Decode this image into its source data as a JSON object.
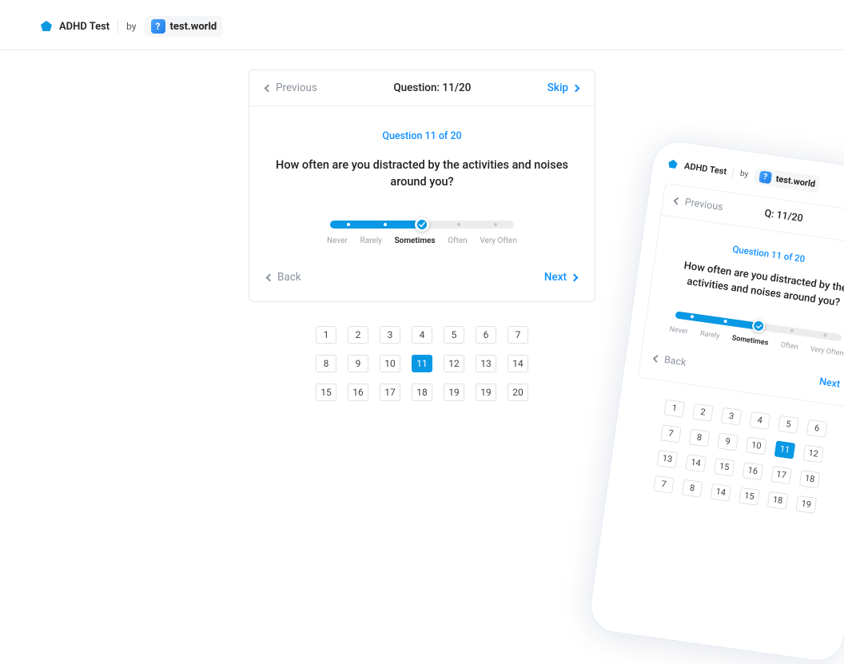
{
  "header": {
    "app_name": "ADHD Test",
    "by_label": "by",
    "brand": "test.world",
    "brand_glyph": "?"
  },
  "card": {
    "prev_label": "Previous",
    "skip_label": "Skip",
    "title_prefix": "Question:",
    "title_value": "11/20",
    "progress": "Question 11 of 20",
    "question": "How often are you distracted by the activities and noises around you?",
    "scale": [
      "Never",
      "Rarely",
      "Sometimes",
      "Often",
      "Very Often"
    ],
    "selected_index": 2,
    "back_label": "Back",
    "next_label": "Next"
  },
  "pager": {
    "total": 20,
    "current": 11,
    "rows": [
      [
        1,
        2,
        3,
        4,
        5,
        6,
        7
      ],
      [
        8,
        9,
        10,
        11,
        12,
        13,
        14
      ],
      [
        15,
        16,
        17,
        18,
        19,
        19,
        20
      ]
    ]
  },
  "phone": {
    "title_prefix": "Q:",
    "title_value": "11/20",
    "pager_rows": [
      [
        1,
        2,
        3,
        4,
        5,
        6
      ],
      [
        7,
        8,
        9,
        10,
        11,
        12
      ],
      [
        13,
        14,
        15,
        16,
        17,
        18
      ],
      [
        7,
        8,
        14,
        15,
        18,
        19
      ]
    ]
  }
}
